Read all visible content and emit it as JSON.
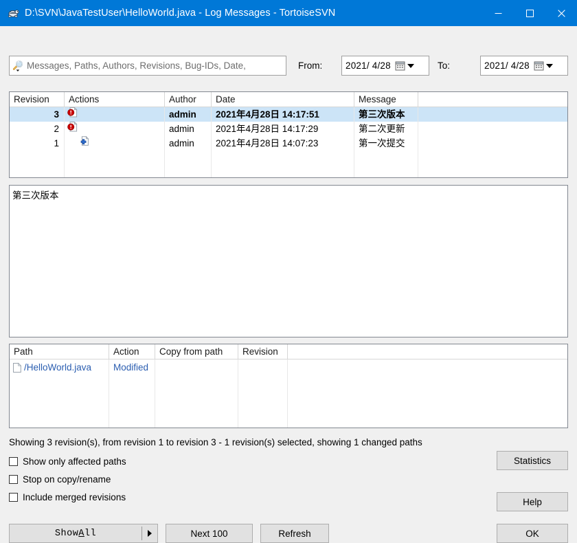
{
  "window": {
    "title": "D:\\SVN\\JavaTestUser\\HelloWorld.java - Log Messages - TortoiseSVN",
    "icon": "tortoisesvn-turtle-icon",
    "minimize_label": "—",
    "maximize_label": "❐",
    "close_label": "✕",
    "accent_color": "#0078d7"
  },
  "filter": {
    "search_icon": "search-icon",
    "search_value": "",
    "search_placeholder": "Messages, Paths, Authors, Revisions, Bug-IDs, Date,",
    "from_label": "From:",
    "from_value": "2021/ 4/28",
    "to_label": "To:",
    "to_value": "2021/ 4/28",
    "calendar_icon": "calendar-icon"
  },
  "revisions": {
    "columns": [
      "Revision",
      "Actions",
      "Author",
      "Date",
      "Message"
    ],
    "rows": [
      {
        "revision": "3",
        "action_icon": "modified-icon",
        "author": "admin",
        "date": "2021年4月28日 14:17:51",
        "message": "第三次版本",
        "selected": true
      },
      {
        "revision": "2",
        "action_icon": "modified-icon",
        "author": "admin",
        "date": "2021年4月28日 14:17:29",
        "message": "第二次更新",
        "selected": false
      },
      {
        "revision": "1",
        "action_icon": "added-icon",
        "author": "admin",
        "date": "2021年4月28日 14:07:23",
        "message": "第一次提交",
        "selected": false
      }
    ]
  },
  "message_pane": {
    "text": "第三次版本"
  },
  "paths": {
    "columns": [
      "Path",
      "Action",
      "Copy from path",
      "Revision"
    ],
    "rows": [
      {
        "path": "/HelloWorld.java",
        "path_icon": "file-icon",
        "action": "Modified",
        "copy_from_path": "",
        "revision": "",
        "link_color": "#2a5db0"
      }
    ]
  },
  "status": {
    "text": "Showing 3 revision(s), from revision 1 to revision 3 - 1 revision(s) selected, showing 1 changed paths"
  },
  "options": [
    {
      "label": "Show only affected paths",
      "checked": false
    },
    {
      "label": "Stop on copy/rename",
      "checked": false
    },
    {
      "label": "Include merged revisions",
      "checked": false
    }
  ],
  "buttons": {
    "show_all_prefix": "Show ",
    "show_all_accel": "A",
    "show_all_suffix": "ll",
    "next_100": "Next 100",
    "refresh": "Refresh",
    "statistics": "Statistics",
    "help": "Help",
    "ok": "OK"
  }
}
